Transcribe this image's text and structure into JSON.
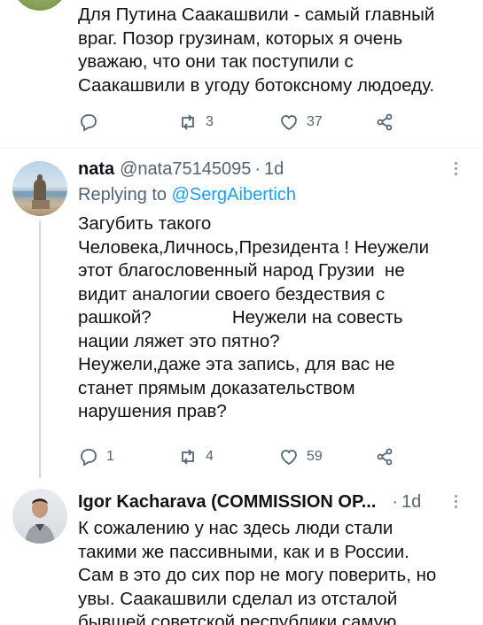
{
  "tweets": [
    {
      "body": "Для Путина Саакашвили - самый главный\nвраг. Позор грузинам, которых я очень\nуважаю, что они так поступили с\nСаакашвили в угоду ботоксному людоеду.",
      "reply_count": "",
      "retweet_count": "3",
      "like_count": "37"
    },
    {
      "name": "nata",
      "handle": "@nata75145095",
      "time": "1d",
      "replying_prefix": "Replying to",
      "replying_to": "@SergAibertich",
      "body": "Загубить такого\nЧеловека,Личнось,Президента ! Неужели\nэтот благословенный народ Грузии  не\nвидит аналогии своего бездествия с\nрашкой?                Неужели на совесть\nнации ляжет это пятно?\nНеужели,даже эта запись, для вас не\nстанет прямым доказательством\nнарушения прав?",
      "reply_count": "1",
      "retweet_count": "4",
      "like_count": "59"
    },
    {
      "name": "Igor Kacharava (COMMISSION OP...",
      "time": "1d",
      "body": "К сожалению у нас здесь люди стали\nтакими же пассивными, как и в России.\nСам в это до сих пор не могу поверить, но\nувы. Саакашвили сделал из отсталой\nбывшей советской республики самую"
    }
  ],
  "colors": {
    "link": "#1d9bf0",
    "secondary_text": "#536471",
    "divider": "#eff3f4",
    "thread_line": "#cfd9de"
  }
}
